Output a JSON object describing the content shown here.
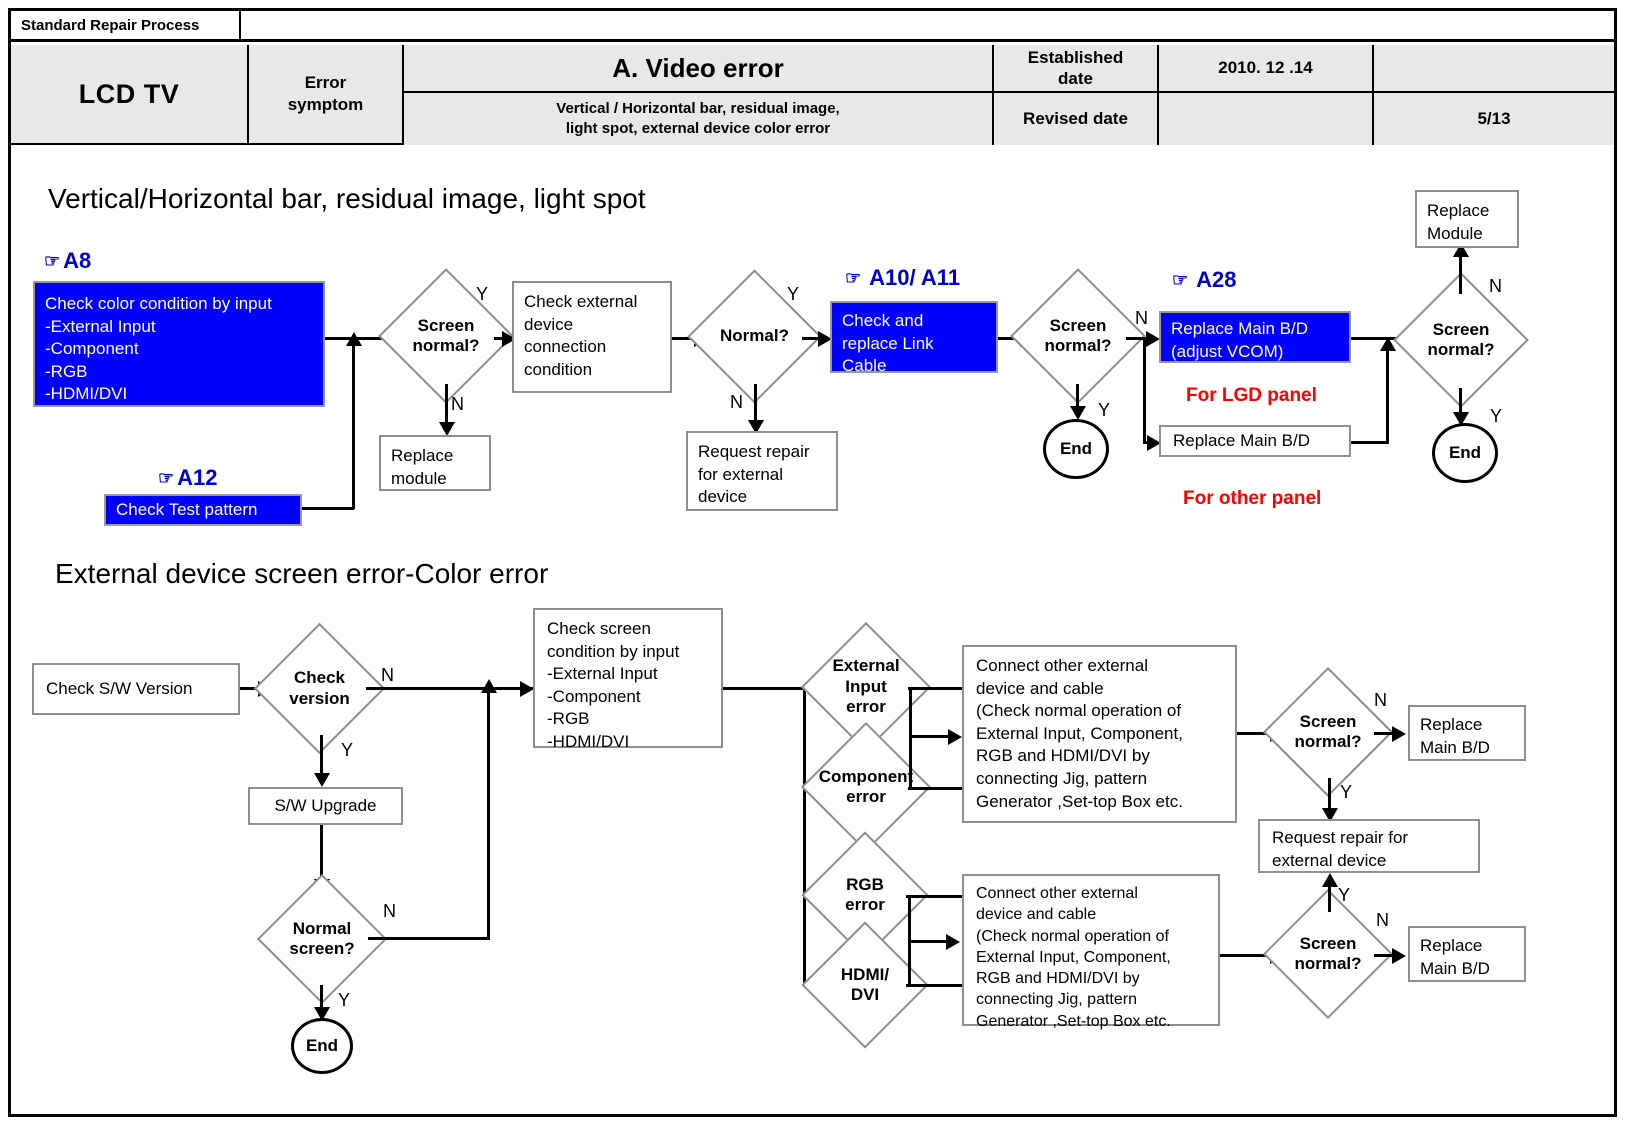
{
  "header": {
    "doc_title": "Standard Repair Process",
    "model": "LCD  TV",
    "error_symptom_label": "Error\nsymptom",
    "error_category": "A. Video error",
    "symptom_detail": "Vertical / Horizontal bar, residual image,\nlight spot, external device color error",
    "established_date_label": "Established\ndate",
    "established_date_value": "2010. 12 .14",
    "revised_date_label": "Revised date",
    "revised_date_value": "",
    "page": "5/13"
  },
  "section1": {
    "title": "Vertical/Horizontal bar, residual image, light spot",
    "refs": {
      "a8": "A8",
      "a12": "A12",
      "a10_a11": "A10/ A11",
      "a28": "A28"
    },
    "nodes": {
      "check_color": "Check color condition by input\n-External Input\n-Component\n-RGB\n-HDMI/DVI",
      "check_test_pattern": "Check Test pattern",
      "screen_normal_1": "Screen\nnormal?",
      "replace_module_1": "Replace\nmodule",
      "check_external": "Check external\ndevice\nconnection\ncondition",
      "normal_q": "Normal?",
      "request_repair_ext": "Request repair\nfor external\ndevice",
      "check_replace_link": "Check and\nreplace Link\nCable",
      "screen_normal_2": "Screen\nnormal?",
      "end_1": "End",
      "replace_main_bd_vcom": "Replace Main B/D\n(adjust VCOM)",
      "replace_main_bd": "Replace Main B/D",
      "screen_normal_3": "Screen\nnormal?",
      "replace_module_2": "Replace\nModule",
      "end_2": "End"
    },
    "notes": {
      "for_lgd_panel": "For LGD panel",
      "for_other_panel": "For other panel"
    },
    "edge_labels": {
      "yes": "Y",
      "no": "N"
    }
  },
  "section2": {
    "title": "External device screen error-Color error",
    "nodes": {
      "check_sw_version": "Check S/W Version",
      "check_version": "Check\nversion",
      "sw_upgrade": "S/W Upgrade",
      "normal_screen": "Normal\nscreen?",
      "end_3": "End",
      "check_screen_cond": "Check screen\ncondition by input\n-External Input\n-Component\n-RGB\n-HDMI/DVI",
      "external_input_error": "External\nInput\nerror",
      "component_error": "Component\nerror",
      "rgb_error": "RGB\nerror",
      "hdmi_dvi": "HDMI/\nDVI",
      "connect_other_1": "Connect other external\ndevice and cable\n(Check normal operation of\nExternal Input, Component,\nRGB and HDMI/DVI by\nconnecting Jig, pattern\nGenerator ,Set-top Box etc.",
      "connect_other_2": "Connect other external\ndevice and cable\n(Check normal operation of\nExternal Input, Component,\nRGB and HDMI/DVI by\nconnecting Jig, pattern\nGenerator ,Set-top Box etc.",
      "screen_normal_4": "Screen\nnormal?",
      "replace_main_bd_1": "Replace\nMain B/D",
      "request_repair_ext_2": "Request repair for\nexternal device",
      "screen_normal_5": "Screen\nnormal?",
      "replace_main_bd_2": "Replace\nMain B/D"
    },
    "edge_labels": {
      "yes": "Y",
      "no": "N"
    }
  },
  "icons": {
    "hand_pointer": "☞"
  },
  "colors": {
    "highlight_blue": "#0000FF",
    "ref_blue": "#0000CC",
    "note_red": "#FF0000",
    "header_fill": "#E8E8E8",
    "shape_border": "#8E8E8E"
  }
}
